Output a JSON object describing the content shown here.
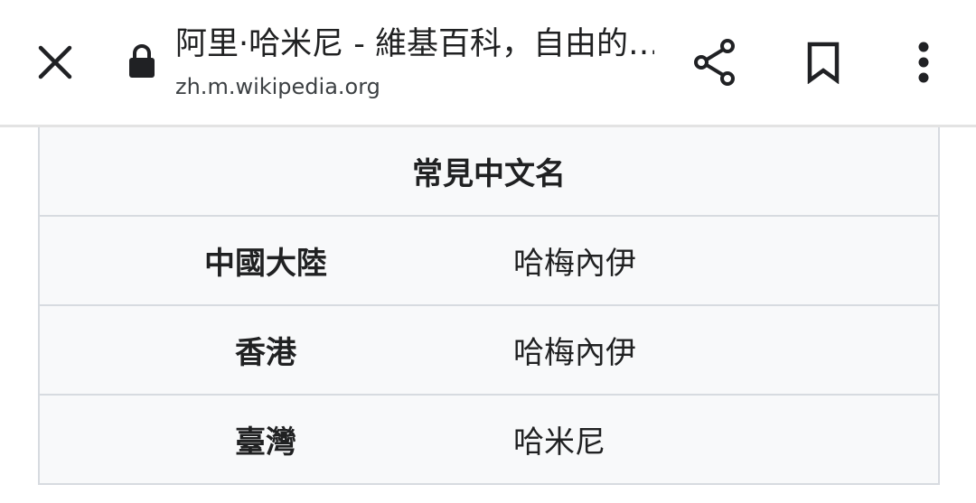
{
  "browser": {
    "page_title": "阿里·哈米尼 - 維基百科，自由的…",
    "url": "zh.m.wikipedia.org",
    "icons": {
      "close": "close-icon",
      "lock": "lock-icon",
      "share": "share-icon",
      "bookmark": "bookmark-icon",
      "more": "more-vert-icon"
    }
  },
  "infobox": {
    "header": "常見中文名",
    "rows": [
      {
        "label": "中國大陸",
        "value": "哈梅內伊"
      },
      {
        "label": "香港",
        "value": "哈梅內伊"
      },
      {
        "label": "臺灣",
        "value": "哈米尼"
      }
    ]
  }
}
